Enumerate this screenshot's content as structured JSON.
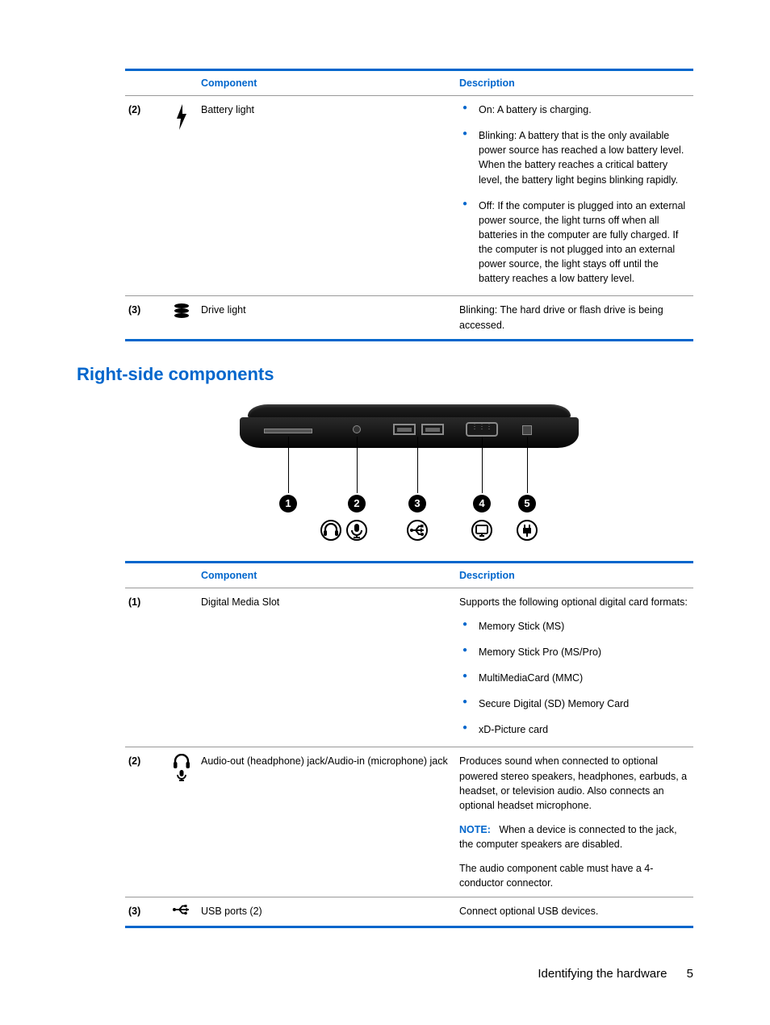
{
  "table1": {
    "header_component": "Component",
    "header_description": "Description",
    "rows": [
      {
        "num": "(2)",
        "component": "Battery light",
        "bullets": [
          "On: A battery is charging.",
          "Blinking: A battery that is the only available power source has reached a low battery level. When the battery reaches a critical battery level, the battery light begins blinking rapidly.",
          "Off: If the computer is plugged into an external power source, the light turns off when all batteries in the computer are fully charged. If the computer is not plugged into an external power source, the light stays off until the battery reaches a low battery level."
        ]
      },
      {
        "num": "(3)",
        "component": "Drive light",
        "description": "Blinking: The hard drive or flash drive is being accessed."
      }
    ]
  },
  "section_heading": "Right-side components",
  "table2": {
    "header_component": "Component",
    "header_description": "Description",
    "rows": [
      {
        "num": "(1)",
        "component": "Digital Media Slot",
        "description_intro": "Supports the following optional digital card formats:",
        "bullets": [
          "Memory Stick (MS)",
          "Memory Stick Pro (MS/Pro)",
          "MultiMediaCard (MMC)",
          "Secure Digital (SD) Memory Card",
          "xD-Picture card"
        ]
      },
      {
        "num": "(2)",
        "component": "Audio-out (headphone) jack/Audio-in (microphone) jack",
        "description": "Produces sound when connected to optional powered stereo speakers, headphones, earbuds, a headset, or television audio. Also connects an optional headset microphone.",
        "note_label": "NOTE:",
        "note_text": "When a device is connected to the jack, the computer speakers are disabled.",
        "extra": "The audio component cable must have a 4-conductor connector."
      },
      {
        "num": "(3)",
        "component": "USB ports (2)",
        "description": "Connect optional USB devices."
      }
    ]
  },
  "footer": {
    "text": "Identifying the hardware",
    "page": "5"
  },
  "callouts": [
    "1",
    "2",
    "3",
    "4",
    "5"
  ]
}
